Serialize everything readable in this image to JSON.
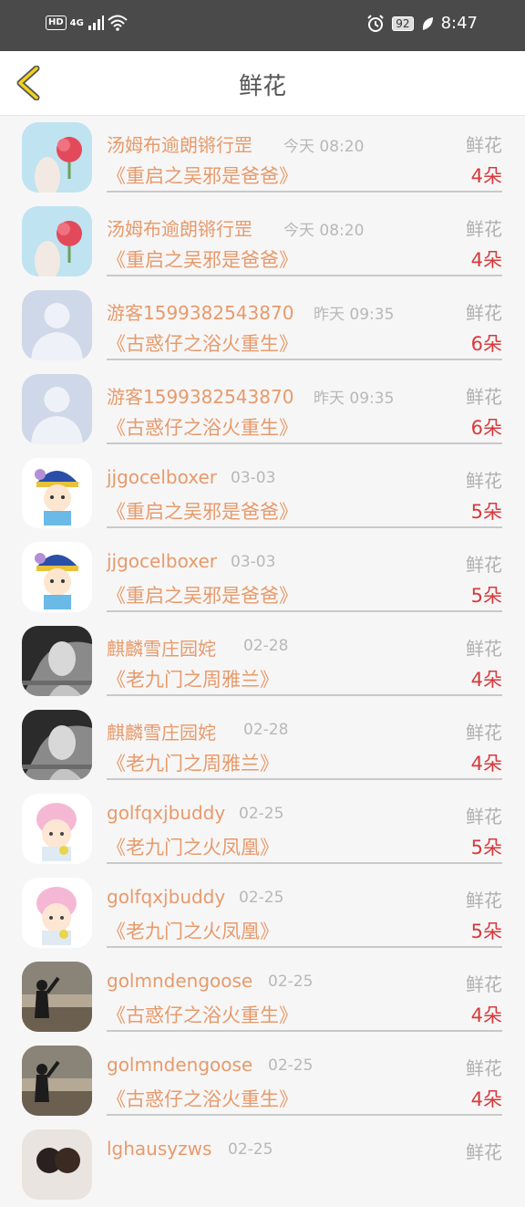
{
  "status": {
    "network": "4G",
    "hd": "HD",
    "battery": "92",
    "time": "8:47"
  },
  "header": {
    "title": "鲜花"
  },
  "rows": [
    {
      "user": "汤姆布逾朗锵行罡",
      "time": "今天 08:20",
      "type": "鲜花",
      "book": "《重启之吴邪是爸爸》",
      "count": "4朵",
      "avatar": "flower"
    },
    {
      "user": "汤姆布逾朗锵行罡",
      "time": "今天 08:20",
      "type": "鲜花",
      "book": "《重启之吴邪是爸爸》",
      "count": "4朵",
      "avatar": "flower"
    },
    {
      "user": "游客1599382543870",
      "time": "昨天 09:35",
      "type": "鲜花",
      "book": "《古惑仔之浴火重生》",
      "count": "6朵",
      "avatar": "default"
    },
    {
      "user": "游客1599382543870",
      "time": "昨天 09:35",
      "type": "鲜花",
      "book": "《古惑仔之浴火重生》",
      "count": "6朵",
      "avatar": "default"
    },
    {
      "user": "jjgocelboxer",
      "time": "03-03",
      "type": "鲜花",
      "book": "《重启之吴邪是爸爸》",
      "count": "5朵",
      "avatar": "cartoon-boy"
    },
    {
      "user": "jjgocelboxer",
      "time": "03-03",
      "type": "鲜花",
      "book": "《重启之吴邪是爸爸》",
      "count": "5朵",
      "avatar": "cartoon-boy"
    },
    {
      "user": "麒麟雪庄园姹",
      "time": "02-28",
      "type": "鲜花",
      "book": "《老九门之周雅兰》",
      "count": "4朵",
      "avatar": "bw-woman"
    },
    {
      "user": "麒麟雪庄园姹",
      "time": "02-28",
      "type": "鲜花",
      "book": "《老九门之周雅兰》",
      "count": "4朵",
      "avatar": "bw-woman"
    },
    {
      "user": "golfqxjbuddy",
      "time": "02-25",
      "type": "鲜花",
      "book": "《老九门之火凤凰》",
      "count": "5朵",
      "avatar": "cartoon-baby"
    },
    {
      "user": "golfqxjbuddy",
      "time": "02-25",
      "type": "鲜花",
      "book": "《老九门之火凤凰》",
      "count": "5朵",
      "avatar": "cartoon-baby"
    },
    {
      "user": "golmndengoose",
      "time": "02-25",
      "type": "鲜花",
      "book": "《古惑仔之浴火重生》",
      "count": "4朵",
      "avatar": "silhouette"
    },
    {
      "user": "golmndengoose",
      "time": "02-25",
      "type": "鲜花",
      "book": "《古惑仔之浴火重生》",
      "count": "4朵",
      "avatar": "silhouette"
    },
    {
      "user": "lghausyzws",
      "time": "02-25",
      "type": "鲜花",
      "book": "",
      "count": "",
      "avatar": "couple"
    }
  ],
  "colors": {
    "accent": "#e79a6b",
    "count": "#d9393c",
    "statusbar": "#4a4a4a"
  }
}
